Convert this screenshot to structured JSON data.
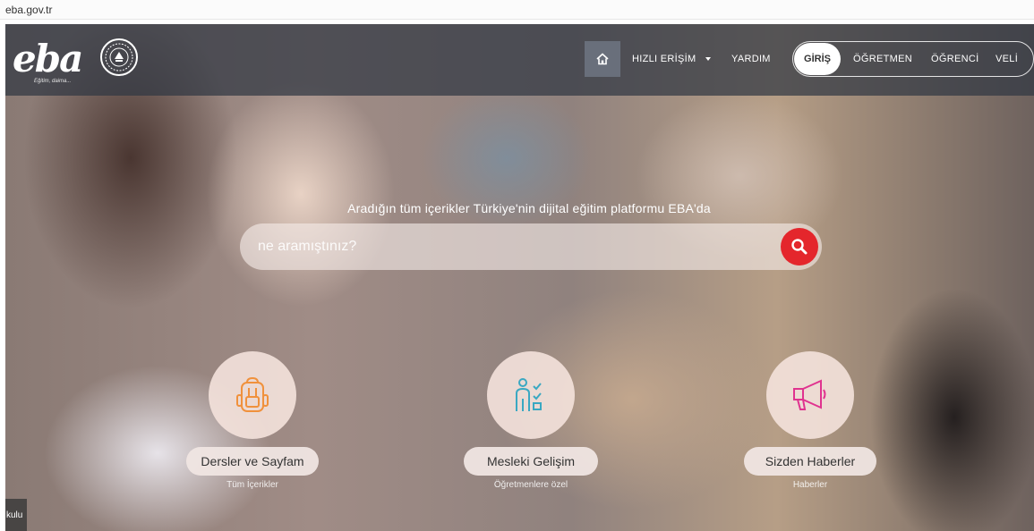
{
  "browser": {
    "url": "eba.gov.tr"
  },
  "header": {
    "logo_text": "eba",
    "logo_slogan": "Eğitim, daima...",
    "nav": {
      "home_icon": "home-icon",
      "hizli_erisim": "HIZLI ERİŞİM",
      "yardim": "YARDIM"
    },
    "login": {
      "giris": "GİRİŞ",
      "ogretmen": "ÖĞRETMEN",
      "ogrenci": "ÖĞRENCİ",
      "veli": "VELİ"
    }
  },
  "hero": {
    "tagline": "Aradığın tüm içerikler Türkiye'nin dijital eğitim platformu EBA'da",
    "search": {
      "placeholder": "ne aramıştınız?",
      "button_icon": "search-icon"
    },
    "cards": [
      {
        "icon": "backpack-icon",
        "label": "Dersler ve Sayfam",
        "sub": "Tüm İçerikler"
      },
      {
        "icon": "teacher-checklist-icon",
        "label": "Mesleki Gelişim",
        "sub": "Öğretmenlere özel"
      },
      {
        "icon": "megaphone-icon",
        "label": "Sizden Haberler",
        "sub": "Haberler"
      }
    ],
    "side_tab": "kulu"
  },
  "colors": {
    "accent_red": "#e4262c",
    "navbar": "#303742",
    "card_icon_orange": "#f0913c",
    "card_icon_teal": "#3aa8c2",
    "card_icon_pink": "#e0338f"
  }
}
